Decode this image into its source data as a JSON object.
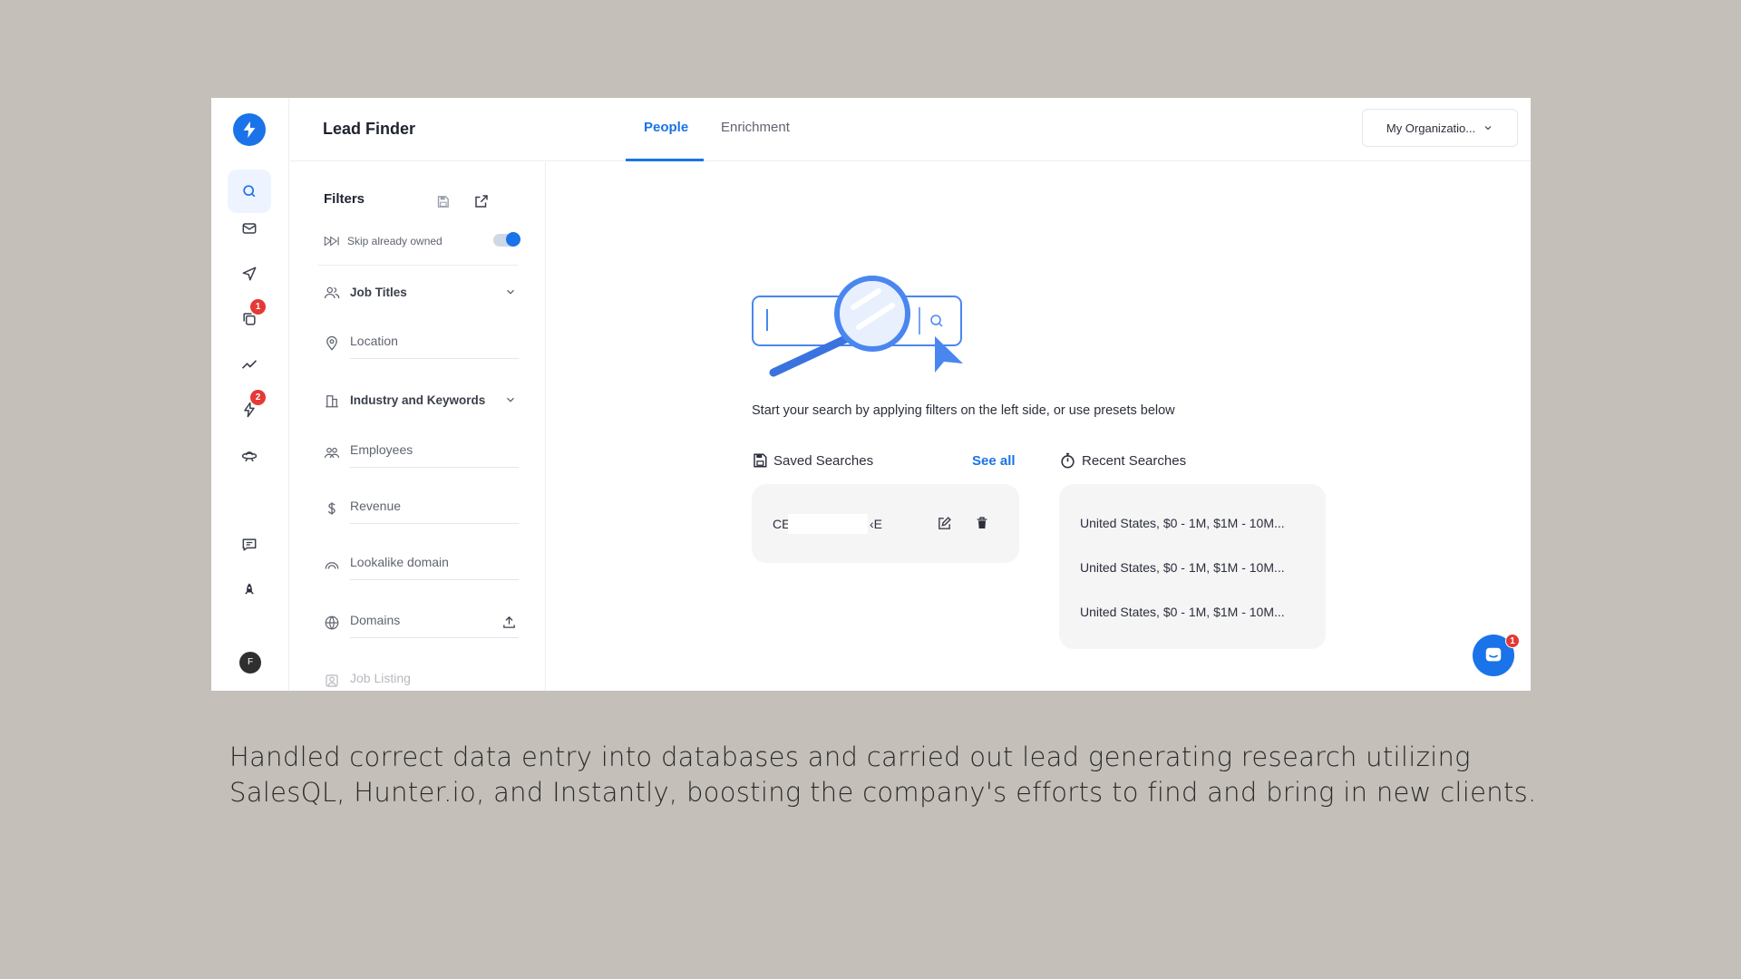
{
  "app": {
    "title": "Lead Finder",
    "tabs": [
      {
        "label": "People",
        "active": true
      },
      {
        "label": "Enrichment",
        "active": false
      }
    ],
    "org_selector": "My Organizatio...",
    "accent_color": "#1a73e8"
  },
  "rail": {
    "items": [
      {
        "icon": "search-icon",
        "active": true
      },
      {
        "icon": "mail-icon"
      },
      {
        "icon": "send-icon"
      },
      {
        "icon": "copy-icon",
        "badge": "1"
      },
      {
        "icon": "trend-icon"
      },
      {
        "icon": "bolt-icon",
        "badge": "2"
      },
      {
        "icon": "ufo-icon"
      },
      {
        "icon": "chat-edit-icon"
      },
      {
        "icon": "rocket-icon"
      }
    ],
    "avatar_initial": "F"
  },
  "filters": {
    "title": "Filters",
    "skip_label": "Skip already owned",
    "skip_enabled": true,
    "items": [
      {
        "label": "Job Titles",
        "icon": "people-icon",
        "expandable": true
      },
      {
        "label": "Location",
        "icon": "location-pin-icon"
      },
      {
        "label": "Industry and Keywords",
        "icon": "building-icon",
        "expandable": true
      },
      {
        "label": "Employees",
        "icon": "employees-icon"
      },
      {
        "label": "Revenue",
        "icon": "dollar-icon"
      },
      {
        "label": "Lookalike domain",
        "icon": "rainbow-icon"
      },
      {
        "label": "Domains",
        "icon": "globe-icon",
        "upload": true
      },
      {
        "label": "Job Listing",
        "icon": "job-listing-icon"
      }
    ]
  },
  "main": {
    "hint": "Start your search by applying filters on the left side, or use presets below",
    "saved_searches": {
      "title": "Saved Searches",
      "see_all": "See all",
      "item_prefix": "CE",
      "item_suffix": "‹E"
    },
    "recent_searches": {
      "title": "Recent Searches",
      "items": [
        "United States, $0 - 1M, $1M - 10M...",
        "United States, $0 - 1M, $1M - 10M...",
        "United States, $0 - 1M, $1M - 10M..."
      ]
    }
  },
  "chat": {
    "badge": "1"
  },
  "caption": "Handled correct data entry into databases and carried out lead generating research utilizing SalesQL, Hunter.io, and Instantly, boosting the company's efforts to find and bring in new clients."
}
